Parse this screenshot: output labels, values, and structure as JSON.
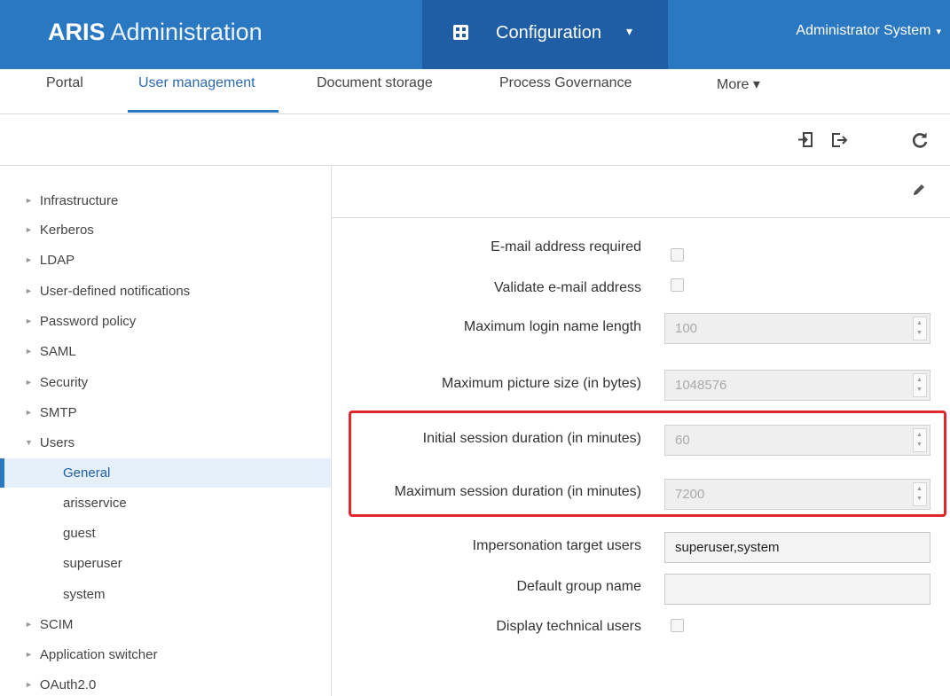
{
  "header": {
    "brand_bold": "ARIS",
    "brand_rest": "Administration",
    "config_label": "Configuration",
    "config_caret": "▾",
    "user_label": "Administrator System",
    "user_caret": "▾"
  },
  "tabs": [
    {
      "label": "Portal"
    },
    {
      "label": "User management"
    },
    {
      "label": "Document storage"
    },
    {
      "label": "Process Governance"
    },
    {
      "label": "More ▾"
    }
  ],
  "sidebar": {
    "items": [
      {
        "label": "Infrastructure"
      },
      {
        "label": "Kerberos"
      },
      {
        "label": "LDAP"
      },
      {
        "label": "User-defined notifications"
      },
      {
        "label": "Password policy"
      },
      {
        "label": "SAML"
      },
      {
        "label": "Security"
      },
      {
        "label": "SMTP"
      },
      {
        "label": "Users"
      },
      {
        "label": "SCIM"
      },
      {
        "label": "Application switcher"
      },
      {
        "label": "OAuth2.0"
      }
    ],
    "collapsed_marker": "►",
    "expanded_marker": "▼",
    "users_children": [
      {
        "label": "General"
      },
      {
        "label": "arisservice"
      },
      {
        "label": "guest"
      },
      {
        "label": "superuser"
      },
      {
        "label": "system"
      }
    ]
  },
  "form": {
    "email_required_label": "E-mail address required",
    "validate_email_label": "Validate e-mail address",
    "max_login_label": "Maximum login name length",
    "max_login_value": "100",
    "max_picture_label": "Maximum picture size (in bytes)",
    "max_picture_value": "1048576",
    "initial_session_label": "Initial session duration (in minutes)",
    "initial_session_value": "60",
    "max_session_label": "Maximum session duration (in minutes)",
    "max_session_value": "7200",
    "impersonation_label": "Impersonation target users",
    "impersonation_value": "superuser,system",
    "default_group_label": "Default group name",
    "default_group_value": "",
    "display_technical_label": "Display technical users",
    "spin_up": "▲",
    "spin_down": "▼"
  },
  "colors": {
    "header_blue": "#2b78c2",
    "config_blue": "#1f5ea5",
    "highlight_red": "#e3262b"
  }
}
